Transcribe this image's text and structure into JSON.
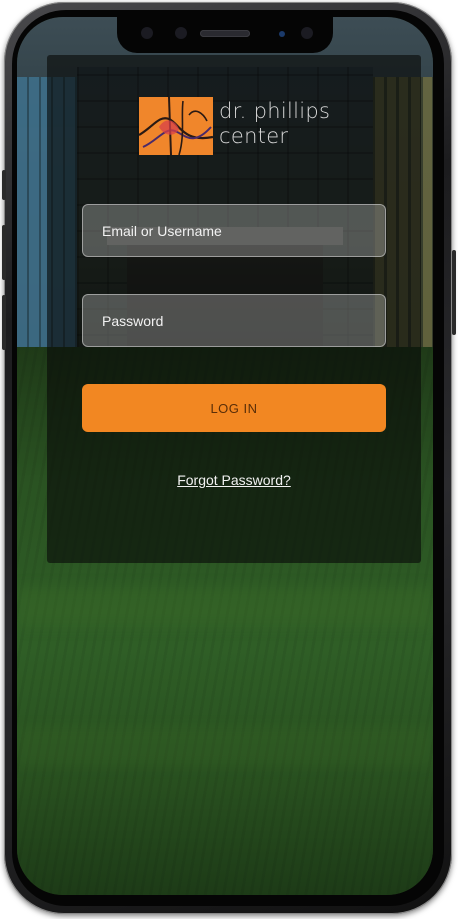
{
  "brand": {
    "name_line1": "dr. phillips",
    "name_line2": "center",
    "color": "#f0862b"
  },
  "login_form": {
    "email_placeholder": "Email or Username",
    "password_placeholder": "Password",
    "login_label": "LOG IN",
    "forgot_label": "Forgot Password?"
  },
  "colors": {
    "accent": "#f28722",
    "overlay": "rgba(8,10,8,0.62)"
  },
  "icons": {
    "logo": "dr-phillips-logo-icon"
  }
}
